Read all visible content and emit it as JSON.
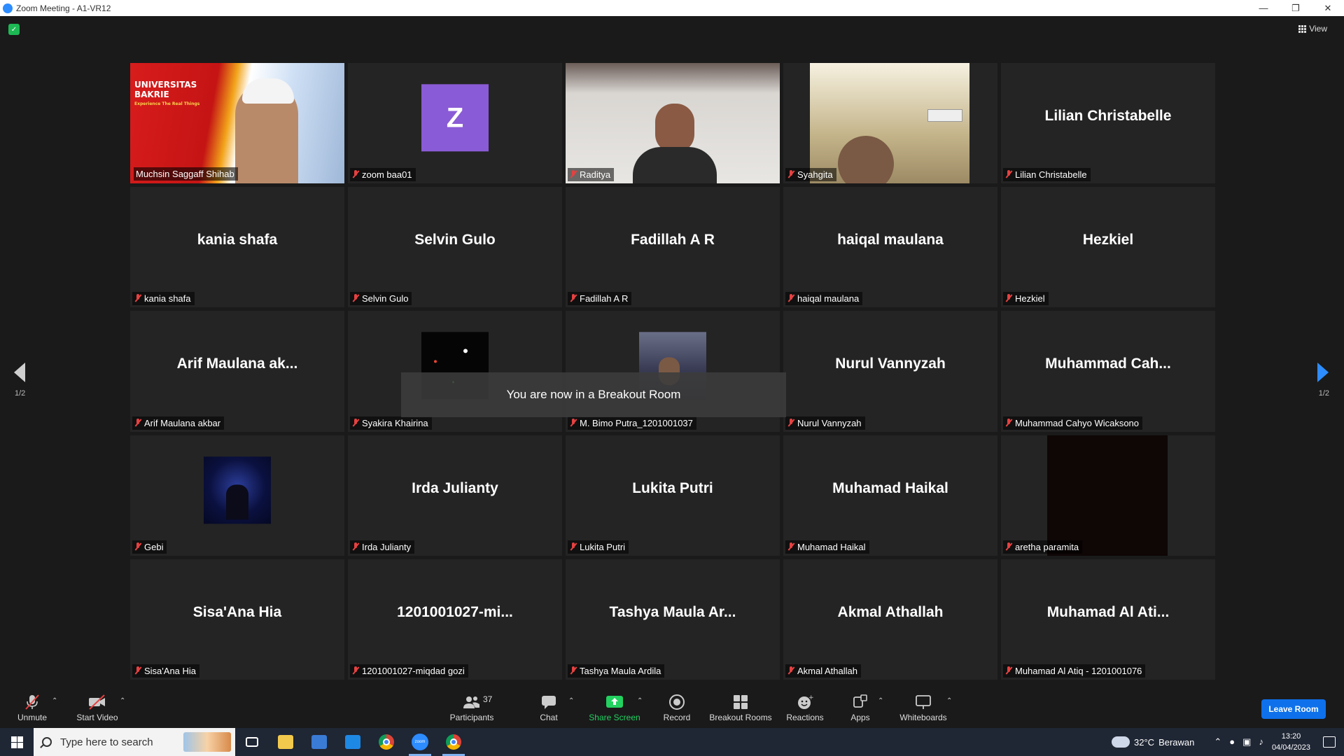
{
  "window": {
    "title": "Zoom Meeting - A1-VR12"
  },
  "top": {
    "view_label": "View"
  },
  "grid": {
    "tiles": [
      {
        "display": "",
        "label": "Muchsin Saggaff Shihab",
        "kind": "video-uni"
      },
      {
        "display": "",
        "label": "zoom baa01",
        "kind": "avatar",
        "avatar_letter": "Z"
      },
      {
        "display": "",
        "label": "Raditya",
        "kind": "video-man"
      },
      {
        "display": "",
        "label": "Syahgita",
        "kind": "video-woman"
      },
      {
        "display": "Lilian Christabelle",
        "label": "Lilian Christabelle",
        "kind": "name"
      },
      {
        "display": "kania shafa",
        "label": "kania shafa",
        "kind": "name"
      },
      {
        "display": "Selvin Gulo",
        "label": "Selvin Gulo",
        "kind": "name"
      },
      {
        "display": "Fadillah A R",
        "label": "Fadillah A R",
        "kind": "name"
      },
      {
        "display": "haiqal maulana",
        "label": "haiqal maulana",
        "kind": "name"
      },
      {
        "display": "Hezkiel",
        "label": "Hezkiel",
        "kind": "name"
      },
      {
        "display": "Arif Maulana ak...",
        "label": "Arif Maulana akbar",
        "kind": "name"
      },
      {
        "display": "",
        "label": "Syakira Khairina",
        "kind": "thumb-space"
      },
      {
        "display": "",
        "label": "M. Bimo Putra_1201001037",
        "kind": "thumb-city"
      },
      {
        "display": "Nurul Vannyzah",
        "label": "Nurul Vannyzah",
        "kind": "name"
      },
      {
        "display": "Muhammad  Cah...",
        "label": "Muhammad Cahyo Wicaksono",
        "kind": "name"
      },
      {
        "display": "",
        "label": "Gebi",
        "kind": "thumb-blue"
      },
      {
        "display": "Irda Julianty",
        "label": "Irda Julianty",
        "kind": "name"
      },
      {
        "display": "Lukita Putri",
        "label": "Lukita Putri",
        "kind": "name"
      },
      {
        "display": "Muhamad Haikal",
        "label": "Muhamad Haikal",
        "kind": "name"
      },
      {
        "display": "",
        "label": "aretha paramita",
        "kind": "video-dark"
      },
      {
        "display": "Sisa'Ana Hia",
        "label": "Sisa'Ana Hia",
        "kind": "name"
      },
      {
        "display": "1201001027-mi...",
        "label": "1201001027-miqdad gozi",
        "kind": "name"
      },
      {
        "display": "Tashya Maula Ar...",
        "label": "Tashya Maula Ardila",
        "kind": "name"
      },
      {
        "display": "Akmal Athallah",
        "label": "Akmal Athallah",
        "kind": "name"
      },
      {
        "display": "Muhamad Al Ati...",
        "label": "Muhamad Al Atiq - 1201001076",
        "kind": "name"
      }
    ],
    "uni_banner": {
      "line1": "UNIVERSITAS",
      "line2": "BAKRIE",
      "line3": "Experience The Real Things"
    }
  },
  "pager": {
    "left": "1/2",
    "right": "1/2"
  },
  "toast": {
    "text": "You are now in a Breakout Room"
  },
  "toolbar": {
    "unmute": "Unmute",
    "start_video": "Start Video",
    "participants": "Participants",
    "participants_count": "37",
    "chat": "Chat",
    "share_screen": "Share Screen",
    "record": "Record",
    "breakout_rooms": "Breakout Rooms",
    "reactions": "Reactions",
    "apps": "Apps",
    "whiteboards": "Whiteboards",
    "leave": "Leave Room"
  },
  "taskbar": {
    "search_placeholder": "Type here to search",
    "weather_temp": "32°C",
    "weather_desc": "Berawan",
    "time": "13:20",
    "date": "04/04/2023"
  },
  "colors": {
    "accent": "#2d8cff",
    "active_speaker": "#e8d92c",
    "muted": "#e64141",
    "share_green": "#23d160",
    "leave": "#0e71eb"
  }
}
